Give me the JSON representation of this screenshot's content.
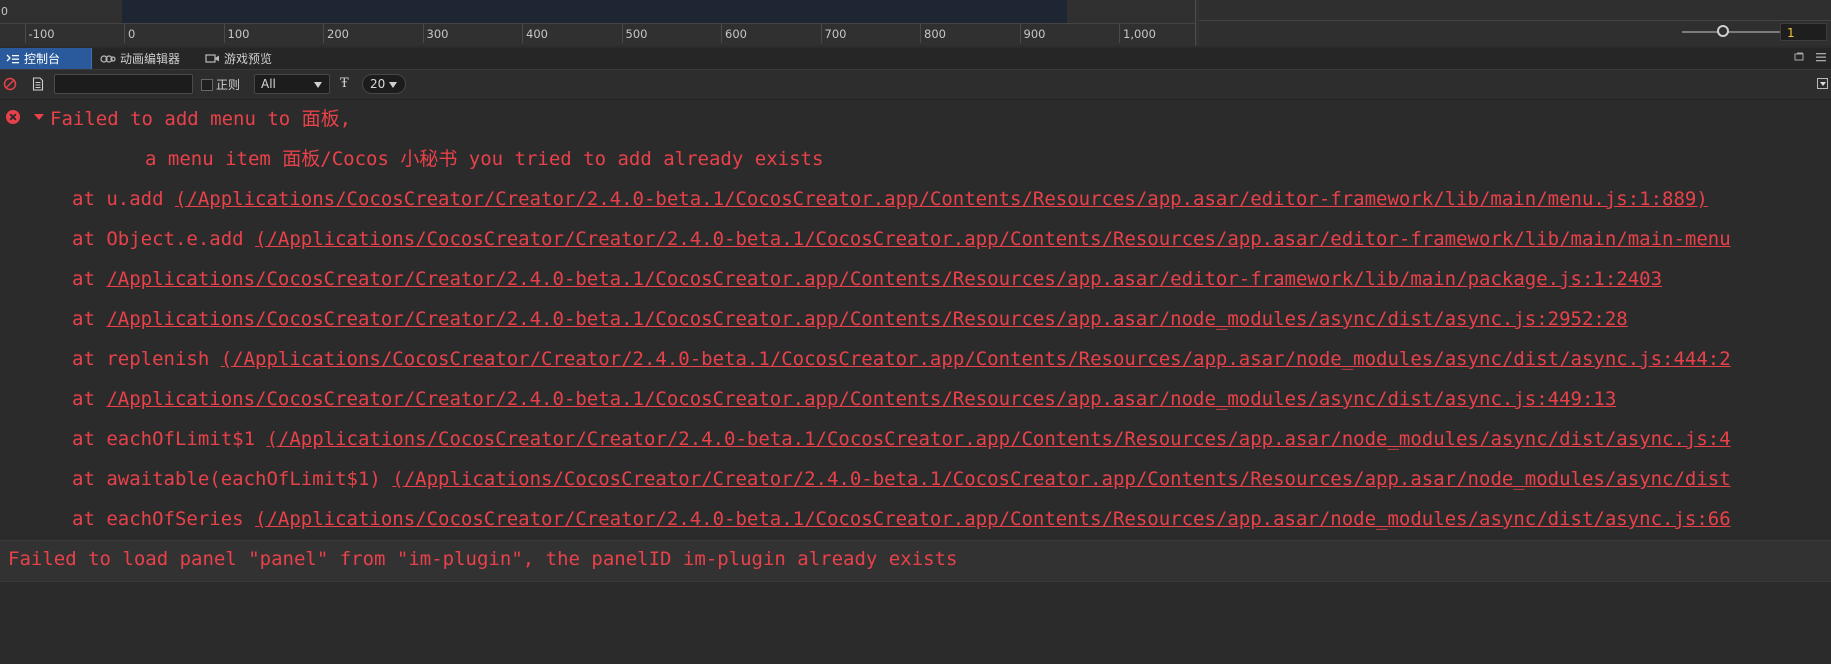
{
  "ruler": {
    "zero_label": "0",
    "ticks": [
      {
        "label": "-100",
        "value": -100
      },
      {
        "label": "0",
        "value": 0
      },
      {
        "label": "100",
        "value": 100
      },
      {
        "label": "200",
        "value": 200
      },
      {
        "label": "300",
        "value": 300
      },
      {
        "label": "400",
        "value": 400
      },
      {
        "label": "500",
        "value": 500
      },
      {
        "label": "600",
        "value": 600
      },
      {
        "label": "700",
        "value": 700
      },
      {
        "label": "800",
        "value": 800
      },
      {
        "label": "900",
        "value": 900
      },
      {
        "label": "1,000",
        "value": 1000
      }
    ],
    "zoom_value": "1"
  },
  "tabs": [
    {
      "label": "控制台",
      "icon": "list-icon",
      "active": true
    },
    {
      "label": "动画编辑器",
      "icon": "animation-icon",
      "active": false
    },
    {
      "label": "游戏预览",
      "icon": "camera-icon",
      "active": false
    }
  ],
  "toolbar": {
    "search_value": "",
    "regex_label": "正则",
    "filter_value": "All",
    "font_size": "20"
  },
  "console": {
    "entry1": {
      "title": "Failed to add menu to 面板,",
      "message": "a menu item 面板/Cocos 小秘书 you tried to add already exists",
      "stack": [
        {
          "prefix": "at u.add  ",
          "path": "(/Applications/CocosCreator/Creator/2.4.0-beta.1/CocosCreator.app/Contents/Resources/app.asar/editor-framework/lib/main/menu.js:1:889)"
        },
        {
          "prefix": "at Object.e.add  ",
          "path": "(/Applications/CocosCreator/Creator/2.4.0-beta.1/CocosCreator.app/Contents/Resources/app.asar/editor-framework/lib/main/main-menu"
        },
        {
          "prefix": "at  ",
          "path": "/Applications/CocosCreator/Creator/2.4.0-beta.1/CocosCreator.app/Contents/Resources/app.asar/editor-framework/lib/main/package.js:1:2403"
        },
        {
          "prefix": "at  ",
          "path": "/Applications/CocosCreator/Creator/2.4.0-beta.1/CocosCreator.app/Contents/Resources/app.asar/node_modules/async/dist/async.js:2952:28"
        },
        {
          "prefix": "at replenish  ",
          "path": "(/Applications/CocosCreator/Creator/2.4.0-beta.1/CocosCreator.app/Contents/Resources/app.asar/node_modules/async/dist/async.js:444:2"
        },
        {
          "prefix": "at  ",
          "path": "/Applications/CocosCreator/Creator/2.4.0-beta.1/CocosCreator.app/Contents/Resources/app.asar/node_modules/async/dist/async.js:449:13"
        },
        {
          "prefix": "at eachOfLimit$1  ",
          "path": "(/Applications/CocosCreator/Creator/2.4.0-beta.1/CocosCreator.app/Contents/Resources/app.asar/node_modules/async/dist/async.js:4"
        },
        {
          "prefix": "at awaitable(eachOfLimit$1)  ",
          "path": "(/Applications/CocosCreator/Creator/2.4.0-beta.1/CocosCreator.app/Contents/Resources/app.asar/node_modules/async/dist"
        },
        {
          "prefix": "at eachOfSeries  ",
          "path": "(/Applications/CocosCreator/Creator/2.4.0-beta.1/CocosCreator.app/Contents/Resources/app.asar/node_modules/async/dist/async.js:66"
        }
      ]
    },
    "entry2": {
      "message": "Failed to load panel \"panel\" from \"im-plugin\", the panelID im-plugin already exists"
    }
  },
  "colors": {
    "error": "#e8414a",
    "active_tab": "#2a5a9c",
    "background": "#2b2b2b",
    "zoom_text": "#f0c23a"
  }
}
